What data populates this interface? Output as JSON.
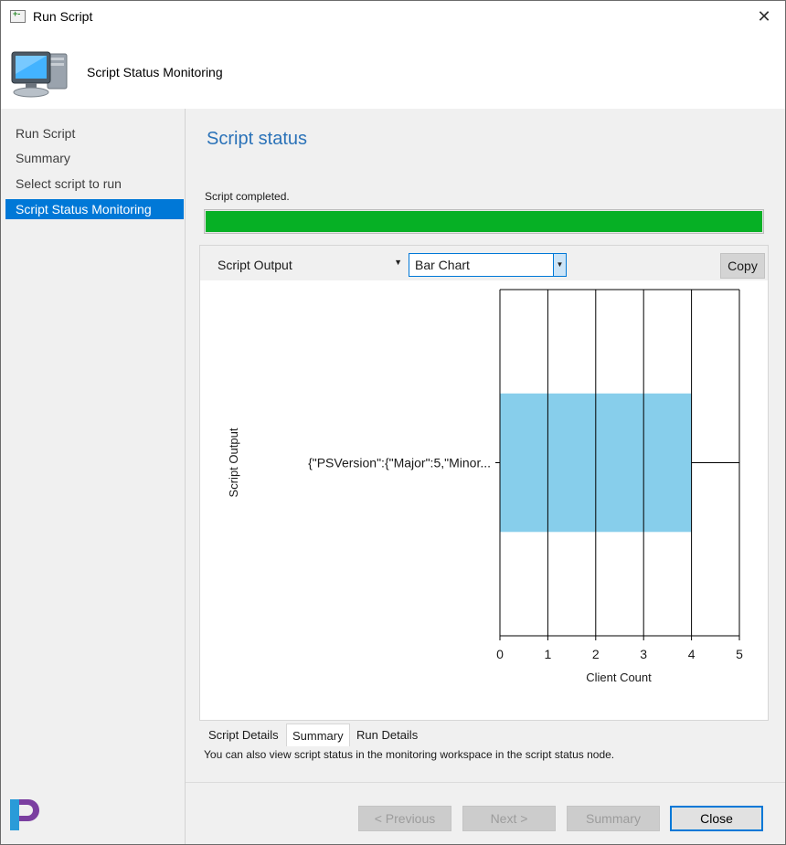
{
  "window": {
    "title": "Run Script"
  },
  "header": {
    "title": "Script Status Monitoring"
  },
  "nav": {
    "items": [
      {
        "label": "Run Script"
      },
      {
        "label": "Summary"
      },
      {
        "label": "Select script to run"
      },
      {
        "label": "Script Status Monitoring",
        "active": true
      }
    ]
  },
  "main": {
    "page_title": "Script status",
    "status_text": "Script completed.",
    "progress": 1.0,
    "output_selector": {
      "value": "Script Output"
    },
    "chart_type_selector": {
      "value": "Bar Chart"
    },
    "copy_label": "Copy",
    "tabs": [
      {
        "label": "Script Details"
      },
      {
        "label": "Summary",
        "active": true
      },
      {
        "label": "Run Details"
      }
    ],
    "info_text": "You can also view script status in the monitoring workspace in the script status node."
  },
  "buttons": {
    "previous": "< Previous",
    "next": "Next >",
    "summary": "Summary",
    "close": "Close"
  },
  "chart_data": {
    "type": "bar",
    "orientation": "horizontal",
    "categories": [
      "{\"PSVersion\":{\"Major\":5,\"Minor..."
    ],
    "values": [
      4
    ],
    "xlabel": "Client Count",
    "ylabel": "Script Output",
    "xlim": [
      0,
      5
    ],
    "xticks": [
      0,
      1,
      2,
      3,
      4,
      5
    ],
    "grid": true,
    "bar_color": "#87ceeb"
  },
  "colors": {
    "accent": "#0078d7",
    "title_blue": "#2a72b8",
    "progress_green": "#06b025"
  }
}
